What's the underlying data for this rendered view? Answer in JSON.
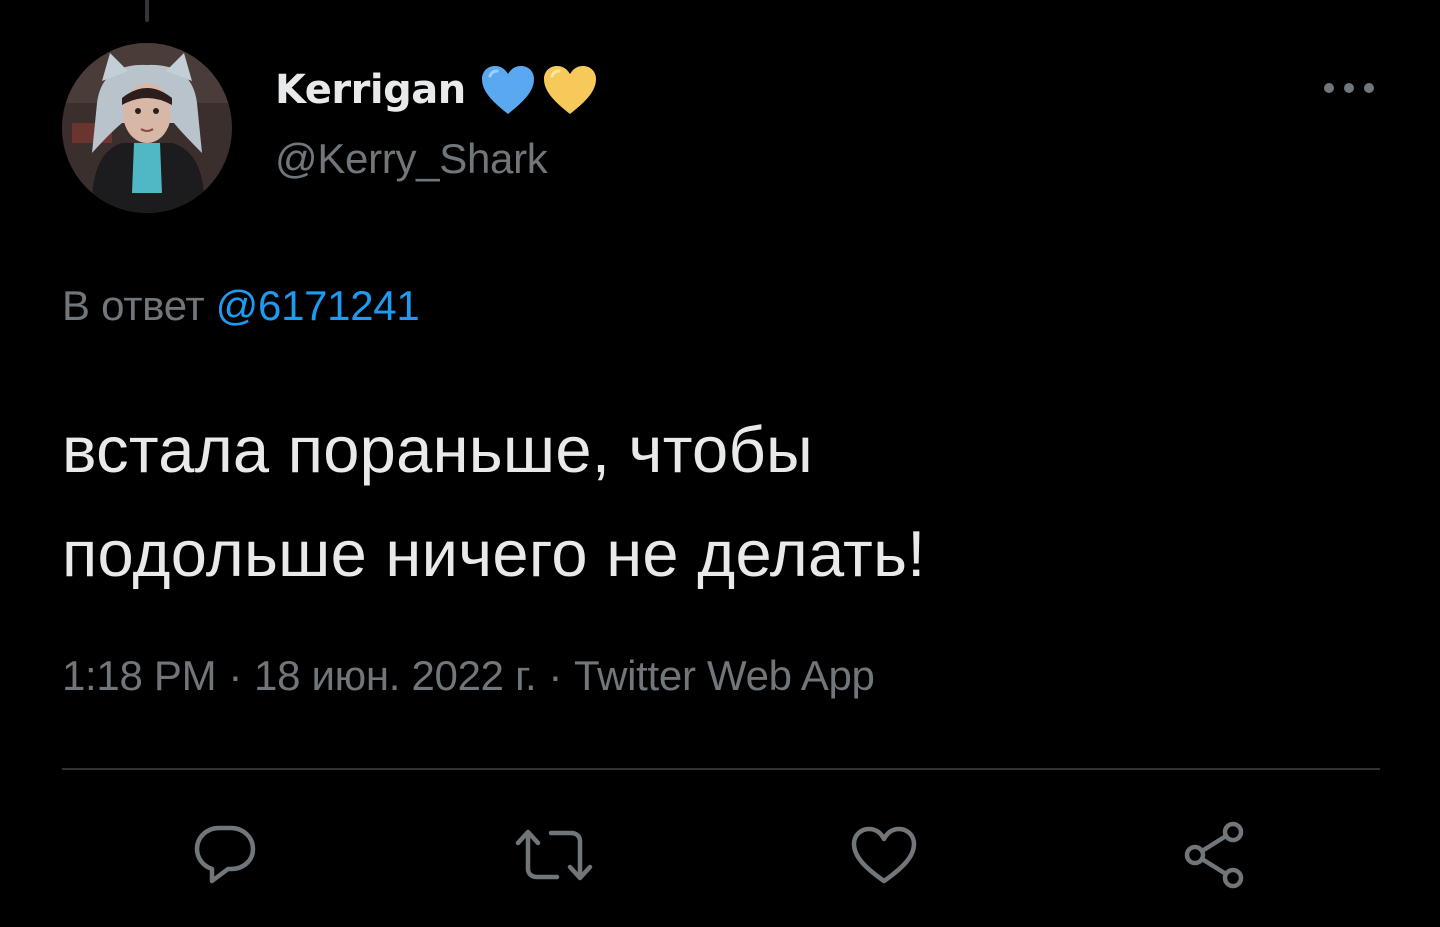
{
  "author": {
    "display_name": "Kerrigan",
    "handle": "@Kerry_Shark",
    "badges": [
      {
        "icon": "blue-heart-icon",
        "color": "#5aa8f0"
      },
      {
        "icon": "yellow-heart-icon",
        "color": "#f7c85a"
      }
    ],
    "avatar_icon": "user-avatar"
  },
  "reply": {
    "prefix": "В ответ",
    "mention": "@6171241"
  },
  "tweet": {
    "text_line_1": "встала пораньше, чтобы",
    "text_line_2": "подольше ничего не делать!"
  },
  "meta": {
    "time": "1:18 PM",
    "date": "18 июн. 2022 г.",
    "source": "Twitter Web App",
    "separator": "·"
  },
  "actions": [
    {
      "name": "reply",
      "icon": "reply-icon"
    },
    {
      "name": "retweet",
      "icon": "retweet-icon"
    },
    {
      "name": "like",
      "icon": "heart-icon"
    },
    {
      "name": "share",
      "icon": "share-icon"
    }
  ],
  "colors": {
    "background": "#000000",
    "primary_text": "#e7e9ea",
    "secondary_text": "#71767b",
    "link": "#1d9bf0",
    "divider": "#2f3336"
  }
}
